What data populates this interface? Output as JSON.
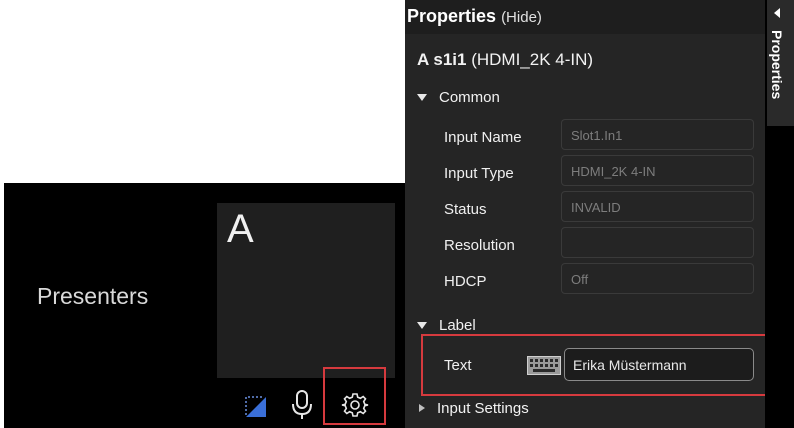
{
  "left": {
    "presenters_label": "Presenters",
    "preview_letter": "A",
    "toolbar": {
      "crop_icon": "crop-icon",
      "mic_icon": "mic-icon",
      "settings_icon": "gear-icon"
    }
  },
  "properties": {
    "title": "Properties",
    "hide_label": "(Hide)",
    "device_id": "A s1i1",
    "device_type": "(HDMI_2K 4-IN)",
    "common_section": "Common",
    "fields": [
      {
        "label": "Input Name",
        "value": "Slot1.In1"
      },
      {
        "label": "Input Type",
        "value": "HDMI_2K 4-IN"
      },
      {
        "label": "Status",
        "value": "INVALID"
      },
      {
        "label": "Resolution",
        "value": ""
      },
      {
        "label": "HDCP",
        "value": "Off"
      }
    ],
    "label_section": "Label",
    "text_label": "Text",
    "text_value": "Erika Müstermann",
    "input_settings_section": "Input Settings"
  },
  "side_tab": {
    "label": "Properties"
  },
  "colors": {
    "highlight": "#d63a3e",
    "panel": "#252525",
    "accent_blue": "#3a6fd8"
  }
}
